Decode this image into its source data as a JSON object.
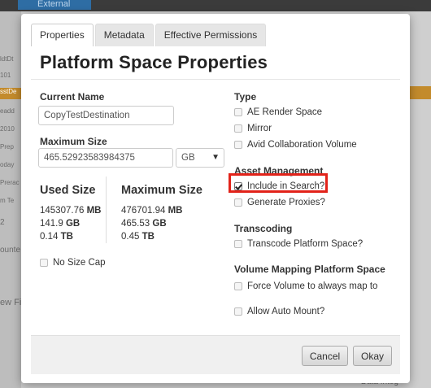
{
  "background": {
    "tab_label": "External",
    "side_rows": [
      "ldtDt",
      "101",
      "sstDe",
      "eadd",
      "2010",
      "Prep",
      "oday",
      "Prerac",
      "m Te",
      "2"
    ],
    "side_word_1": "ounte",
    "side_word_2": "ew Fi",
    "bottom_hint": "Data Integ"
  },
  "tabs": [
    {
      "label": "Properties",
      "active": true
    },
    {
      "label": "Metadata",
      "active": false
    },
    {
      "label": "Effective Permissions",
      "active": false
    }
  ],
  "title": "Platform Space Properties",
  "current_name": {
    "label": "Current Name",
    "value": "CopyTestDestination"
  },
  "maximum_size": {
    "label": "Maximum Size",
    "value": "465.52923583984375",
    "unit": "GB"
  },
  "stats": {
    "used_heading": "Used Size",
    "max_heading": "Maximum Size",
    "used": [
      {
        "value": "145307.76",
        "unit": "MB"
      },
      {
        "value": "141.9",
        "unit": "GB"
      },
      {
        "value": "0.14",
        "unit": "TB"
      }
    ],
    "max": [
      {
        "value": "476701.94",
        "unit": "MB"
      },
      {
        "value": "465.53",
        "unit": "GB"
      },
      {
        "value": "0.45",
        "unit": "TB"
      }
    ]
  },
  "no_size_cap": {
    "label": "No Size Cap",
    "checked": false
  },
  "type": {
    "heading": "Type",
    "options": [
      {
        "label": "AE Render Space",
        "checked": false
      },
      {
        "label": "Mirror",
        "checked": false
      },
      {
        "label": "Avid Collaboration Volume",
        "checked": false
      }
    ]
  },
  "asset_management": {
    "heading": "Asset Management",
    "include_in_search": {
      "label": "Include in Search?",
      "checked": true
    },
    "generate_proxies": {
      "label": "Generate Proxies?",
      "checked": false
    }
  },
  "transcoding": {
    "heading": "Transcoding",
    "option": {
      "label": "Transcode Platform Space?",
      "checked": false
    }
  },
  "volume_mapping": {
    "heading": "Volume Mapping Platform Space",
    "force": {
      "label": "Force Volume to always map to",
      "checked": false
    },
    "auto_mount": {
      "label": "Allow Auto Mount?",
      "checked": false
    }
  },
  "buttons": {
    "cancel": "Cancel",
    "okay": "Okay"
  },
  "colors": {
    "highlight": "#e2231a"
  }
}
